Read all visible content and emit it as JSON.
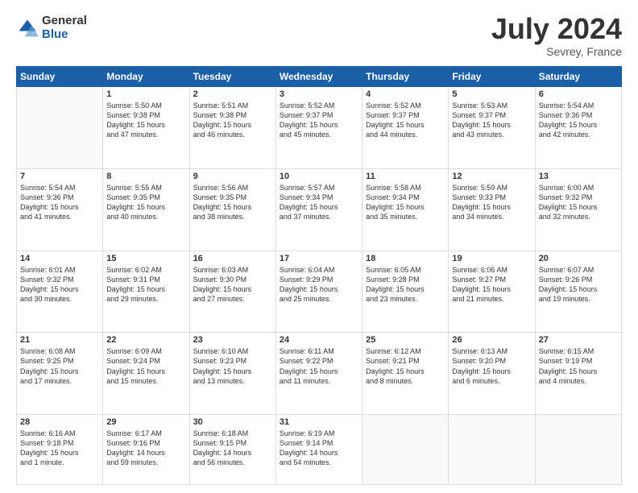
{
  "logo": {
    "general": "General",
    "blue": "Blue"
  },
  "title": "July 2024",
  "location": "Sevrey, France",
  "days": [
    "Sunday",
    "Monday",
    "Tuesday",
    "Wednesday",
    "Thursday",
    "Friday",
    "Saturday"
  ],
  "weeks": [
    [
      {
        "num": "",
        "info": ""
      },
      {
        "num": "1",
        "info": "Sunrise: 5:50 AM\nSunset: 9:38 PM\nDaylight: 15 hours\nand 47 minutes."
      },
      {
        "num": "2",
        "info": "Sunrise: 5:51 AM\nSunset: 9:38 PM\nDaylight: 15 hours\nand 46 minutes."
      },
      {
        "num": "3",
        "info": "Sunrise: 5:52 AM\nSunset: 9:37 PM\nDaylight: 15 hours\nand 45 minutes."
      },
      {
        "num": "4",
        "info": "Sunrise: 5:52 AM\nSunset: 9:37 PM\nDaylight: 15 hours\nand 44 minutes."
      },
      {
        "num": "5",
        "info": "Sunrise: 5:53 AM\nSunset: 9:37 PM\nDaylight: 15 hours\nand 43 minutes."
      },
      {
        "num": "6",
        "info": "Sunrise: 5:54 AM\nSunset: 9:36 PM\nDaylight: 15 hours\nand 42 minutes."
      }
    ],
    [
      {
        "num": "7",
        "info": "Sunrise: 5:54 AM\nSunset: 9:36 PM\nDaylight: 15 hours\nand 41 minutes."
      },
      {
        "num": "8",
        "info": "Sunrise: 5:55 AM\nSunset: 9:35 PM\nDaylight: 15 hours\nand 40 minutes."
      },
      {
        "num": "9",
        "info": "Sunrise: 5:56 AM\nSunset: 9:35 PM\nDaylight: 15 hours\nand 38 minutes."
      },
      {
        "num": "10",
        "info": "Sunrise: 5:57 AM\nSunset: 9:34 PM\nDaylight: 15 hours\nand 37 minutes."
      },
      {
        "num": "11",
        "info": "Sunrise: 5:58 AM\nSunset: 9:34 PM\nDaylight: 15 hours\nand 35 minutes."
      },
      {
        "num": "12",
        "info": "Sunrise: 5:59 AM\nSunset: 9:33 PM\nDaylight: 15 hours\nand 34 minutes."
      },
      {
        "num": "13",
        "info": "Sunrise: 6:00 AM\nSunset: 9:32 PM\nDaylight: 15 hours\nand 32 minutes."
      }
    ],
    [
      {
        "num": "14",
        "info": "Sunrise: 6:01 AM\nSunset: 9:32 PM\nDaylight: 15 hours\nand 30 minutes."
      },
      {
        "num": "15",
        "info": "Sunrise: 6:02 AM\nSunset: 9:31 PM\nDaylight: 15 hours\nand 29 minutes."
      },
      {
        "num": "16",
        "info": "Sunrise: 6:03 AM\nSunset: 9:30 PM\nDaylight: 15 hours\nand 27 minutes."
      },
      {
        "num": "17",
        "info": "Sunrise: 6:04 AM\nSunset: 9:29 PM\nDaylight: 15 hours\nand 25 minutes."
      },
      {
        "num": "18",
        "info": "Sunrise: 6:05 AM\nSunset: 9:28 PM\nDaylight: 15 hours\nand 23 minutes."
      },
      {
        "num": "19",
        "info": "Sunrise: 6:06 AM\nSunset: 9:27 PM\nDaylight: 15 hours\nand 21 minutes."
      },
      {
        "num": "20",
        "info": "Sunrise: 6:07 AM\nSunset: 9:26 PM\nDaylight: 15 hours\nand 19 minutes."
      }
    ],
    [
      {
        "num": "21",
        "info": "Sunrise: 6:08 AM\nSunset: 9:25 PM\nDaylight: 15 hours\nand 17 minutes."
      },
      {
        "num": "22",
        "info": "Sunrise: 6:09 AM\nSunset: 9:24 PM\nDaylight: 15 hours\nand 15 minutes."
      },
      {
        "num": "23",
        "info": "Sunrise: 6:10 AM\nSunset: 9:23 PM\nDaylight: 15 hours\nand 13 minutes."
      },
      {
        "num": "24",
        "info": "Sunrise: 6:11 AM\nSunset: 9:22 PM\nDaylight: 15 hours\nand 11 minutes."
      },
      {
        "num": "25",
        "info": "Sunrise: 6:12 AM\nSunset: 9:21 PM\nDaylight: 15 hours\nand 8 minutes."
      },
      {
        "num": "26",
        "info": "Sunrise: 6:13 AM\nSunset: 9:20 PM\nDaylight: 15 hours\nand 6 minutes."
      },
      {
        "num": "27",
        "info": "Sunrise: 6:15 AM\nSunset: 9:19 PM\nDaylight: 15 hours\nand 4 minutes."
      }
    ],
    [
      {
        "num": "28",
        "info": "Sunrise: 6:16 AM\nSunset: 9:18 PM\nDaylight: 15 hours\nand 1 minute."
      },
      {
        "num": "29",
        "info": "Sunrise: 6:17 AM\nSunset: 9:16 PM\nDaylight: 14 hours\nand 59 minutes."
      },
      {
        "num": "30",
        "info": "Sunrise: 6:18 AM\nSunset: 9:15 PM\nDaylight: 14 hours\nand 56 minutes."
      },
      {
        "num": "31",
        "info": "Sunrise: 6:19 AM\nSunset: 9:14 PM\nDaylight: 14 hours\nand 54 minutes."
      },
      {
        "num": "",
        "info": ""
      },
      {
        "num": "",
        "info": ""
      },
      {
        "num": "",
        "info": ""
      }
    ]
  ]
}
